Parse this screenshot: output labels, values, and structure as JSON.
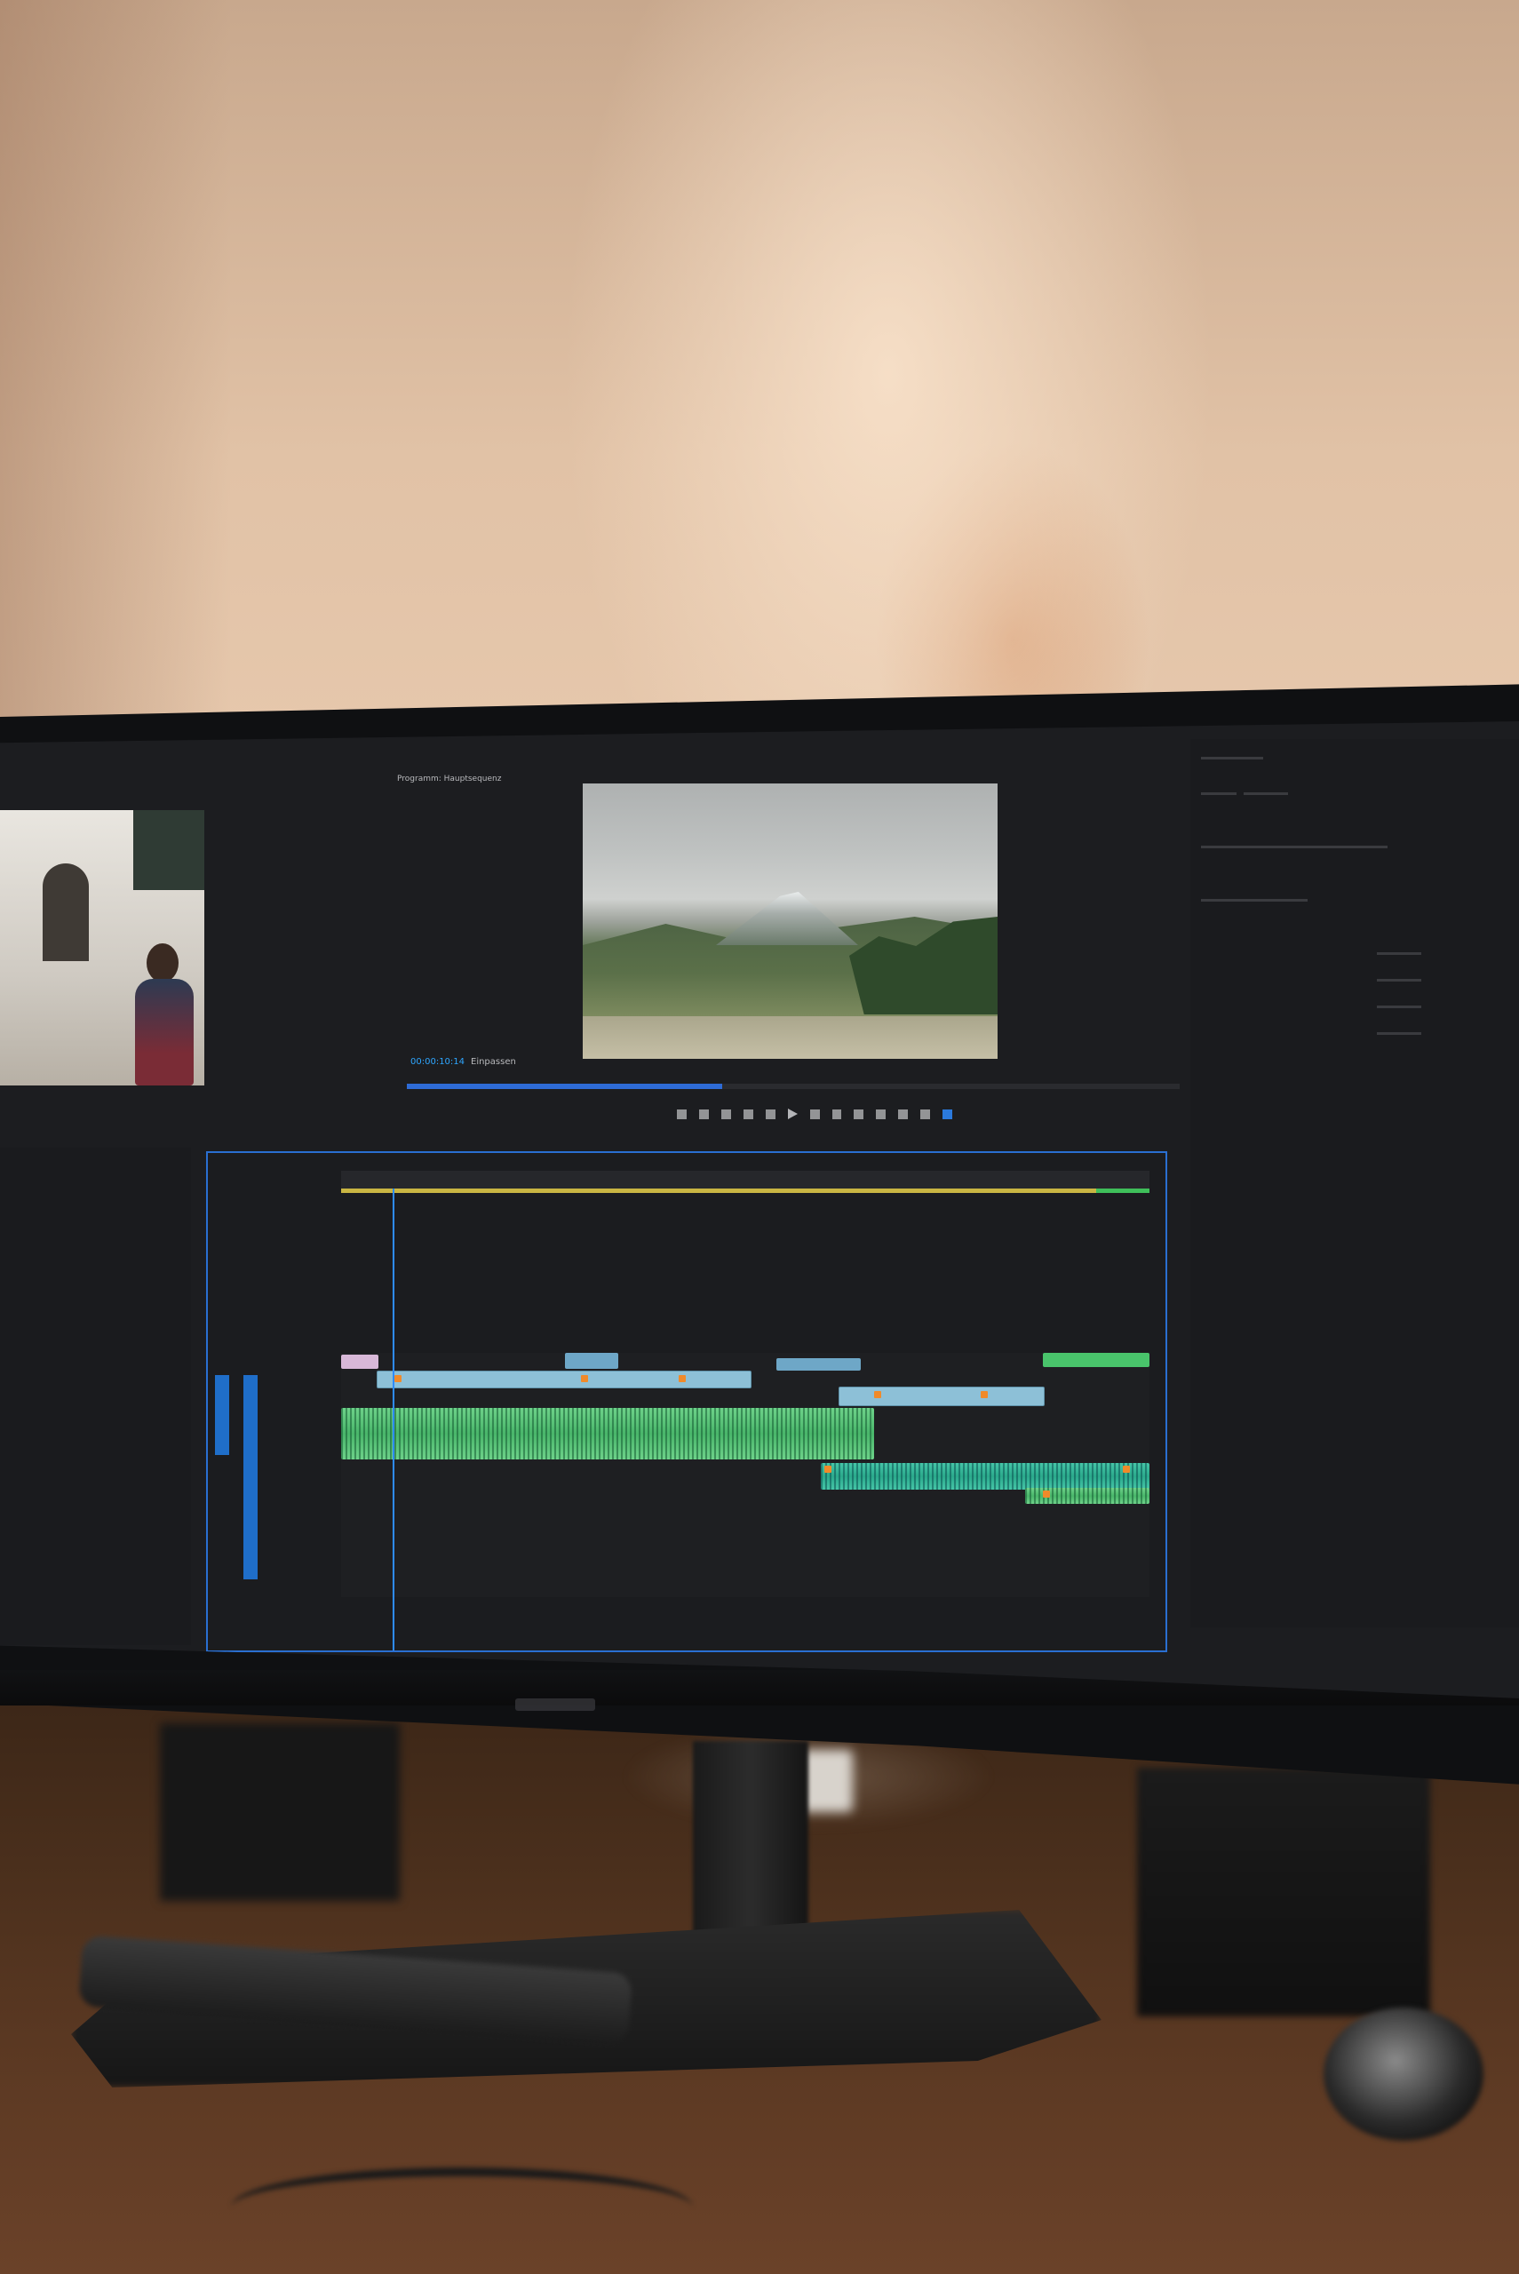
{
  "program_monitor": {
    "title": "Programm: Hauptsequenz",
    "timecode": "00:00:10:14",
    "fit_label": "Einpassen"
  }
}
